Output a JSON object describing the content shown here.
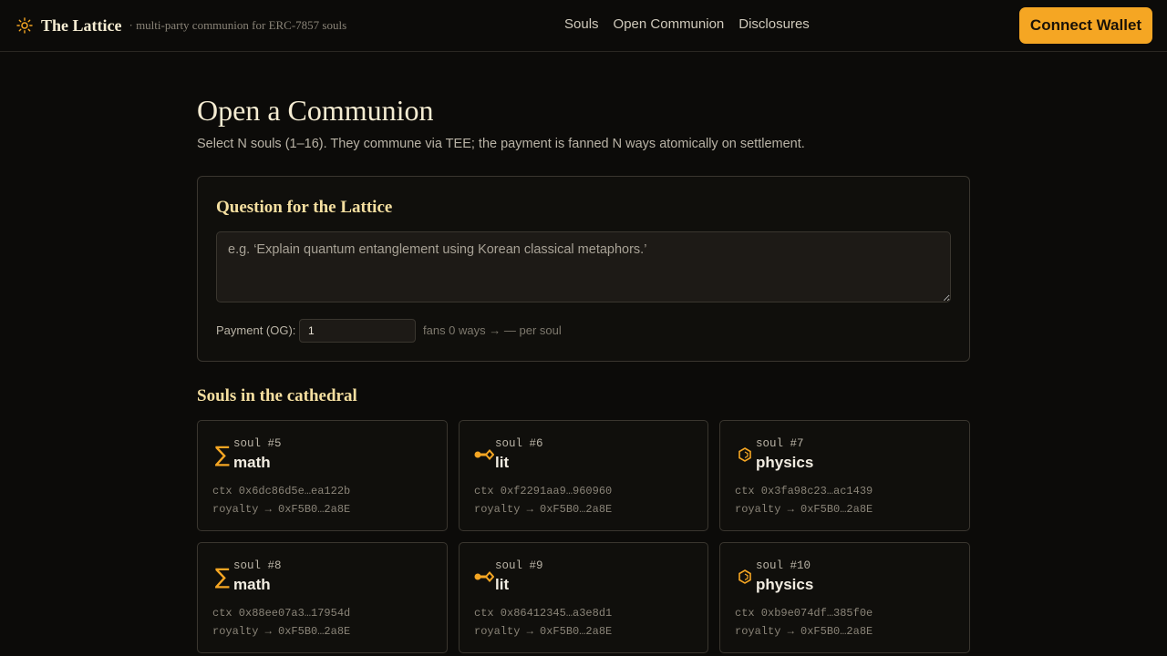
{
  "header": {
    "brand_name": "The Lattice",
    "brand_tagline": "· multi-party communion for ERC-7857 souls",
    "brand_icon": "sun-icon",
    "nav": [
      "Souls",
      "Open Communion",
      "Disclosures"
    ],
    "connect_label": "Connect Wallet"
  },
  "main": {
    "title": "Open a Communion",
    "subtitle": "Select N souls (1–16). They commune via TEE; the payment is fanned N ways atomically on settlement.",
    "question": {
      "title": "Question for the Lattice",
      "placeholder": "e.g. ‘Explain quantum entanglement using Korean classical metaphors.’",
      "value": "",
      "payment_label": "Payment (OG):",
      "payment_value": "1",
      "payment_hint": "fans 0 ways → — per soul"
    },
    "souls_title": "Souls in the cathedral",
    "souls": [
      {
        "num": "soul #5",
        "name": "math",
        "icon": "sigma-icon",
        "ctx": "ctx 0x6dc86d5e…ea122b",
        "royalty": "royalty → 0xF5B0…2a8E"
      },
      {
        "num": "soul #6",
        "name": "lit",
        "icon": "quill-icon",
        "ctx": "ctx 0xf2291aa9…960960",
        "royalty": "royalty → 0xF5B0…2a8E"
      },
      {
        "num": "soul #7",
        "name": "physics",
        "icon": "hexagon-icon",
        "ctx": "ctx 0x3fa98c23…ac1439",
        "royalty": "royalty → 0xF5B0…2a8E"
      },
      {
        "num": "soul #8",
        "name": "math",
        "icon": "sigma-icon",
        "ctx": "ctx 0x88ee07a3…17954d",
        "royalty": "royalty → 0xF5B0…2a8E"
      },
      {
        "num": "soul #9",
        "name": "lit",
        "icon": "quill-icon",
        "ctx": "ctx 0x86412345…a3e8d1",
        "royalty": "royalty → 0xF5B0…2a8E"
      },
      {
        "num": "soul #10",
        "name": "physics",
        "icon": "hexagon-icon",
        "ctx": "ctx 0xb9e074df…385f0e",
        "royalty": "royalty → 0xF5B0…2a8E"
      }
    ]
  },
  "colors": {
    "background": "#0c0b09",
    "accent": "#f5a623",
    "heading_gold": "#f5dfa0"
  }
}
